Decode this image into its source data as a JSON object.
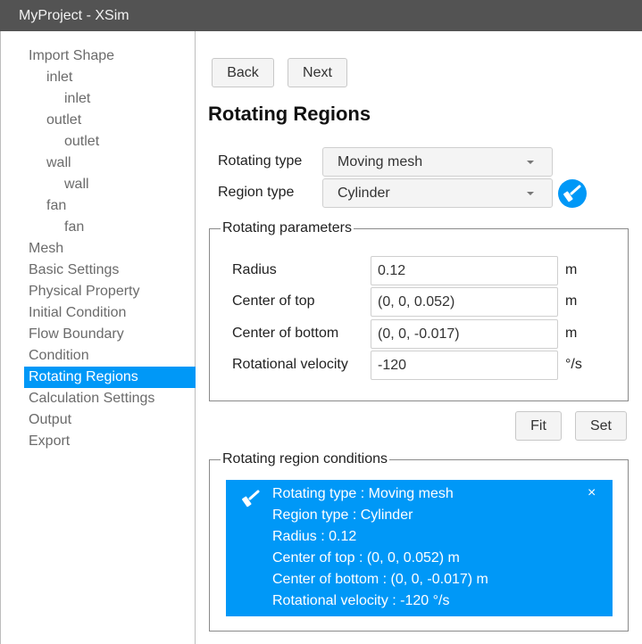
{
  "window": {
    "title": "MyProject - XSim"
  },
  "sidebar": {
    "items": [
      {
        "label": "Import Shape",
        "level": 0
      },
      {
        "label": "inlet",
        "level": 1
      },
      {
        "label": "inlet",
        "level": 2
      },
      {
        "label": "outlet",
        "level": 1
      },
      {
        "label": "outlet",
        "level": 2
      },
      {
        "label": "wall",
        "level": 1
      },
      {
        "label": "wall",
        "level": 2
      },
      {
        "label": "fan",
        "level": 1
      },
      {
        "label": "fan",
        "level": 2
      },
      {
        "label": "Mesh",
        "level": 0
      },
      {
        "label": "Basic Settings",
        "level": 0
      },
      {
        "label": "Physical Property",
        "level": 0
      },
      {
        "label": "Initial Condition",
        "level": 0
      },
      {
        "label": "Flow Boundary",
        "level": 0
      },
      {
        "label": "Condition",
        "level": 0
      },
      {
        "label": "Rotating Regions",
        "level": 0,
        "active": true
      },
      {
        "label": "Calculation Settings",
        "level": 0
      },
      {
        "label": "Output",
        "level": 0
      },
      {
        "label": "Export",
        "level": 0
      }
    ]
  },
  "nav": {
    "back_label": "Back",
    "next_label": "Next"
  },
  "page": {
    "title": "Rotating Regions"
  },
  "form": {
    "rotating_type": {
      "label": "Rotating type",
      "value": "Moving mesh"
    },
    "region_type": {
      "label": "Region type",
      "value": "Cylinder"
    },
    "brush_icon": "paint-roller-icon"
  },
  "parameters": {
    "legend": "Rotating parameters",
    "rows": [
      {
        "label": "Radius",
        "value": "0.12",
        "unit": "m"
      },
      {
        "label": "Center of top",
        "value": "(0, 0, 0.052)",
        "unit": "m"
      },
      {
        "label": "Center of bottom",
        "value": "(0, 0, -0.017)",
        "unit": "m"
      },
      {
        "label": "Rotational velocity",
        "value": "-120",
        "unit": "°/s"
      }
    ]
  },
  "actions": {
    "fit_label": "Fit",
    "set_label": "Set"
  },
  "conditions": {
    "legend": "Rotating region conditions",
    "card": {
      "lines": [
        "Rotating type : Moving mesh",
        "Region type : Cylinder",
        "Radius : 0.12",
        "Center of top : (0, 0, 0.052) m",
        "Center of bottom : (0, 0, -0.017) m",
        "Rotational velocity : -120 °/s"
      ],
      "close_glyph": "×",
      "color": "#0098f7"
    }
  },
  "colors": {
    "accent": "#0098f7",
    "titlebar": "#535353"
  }
}
